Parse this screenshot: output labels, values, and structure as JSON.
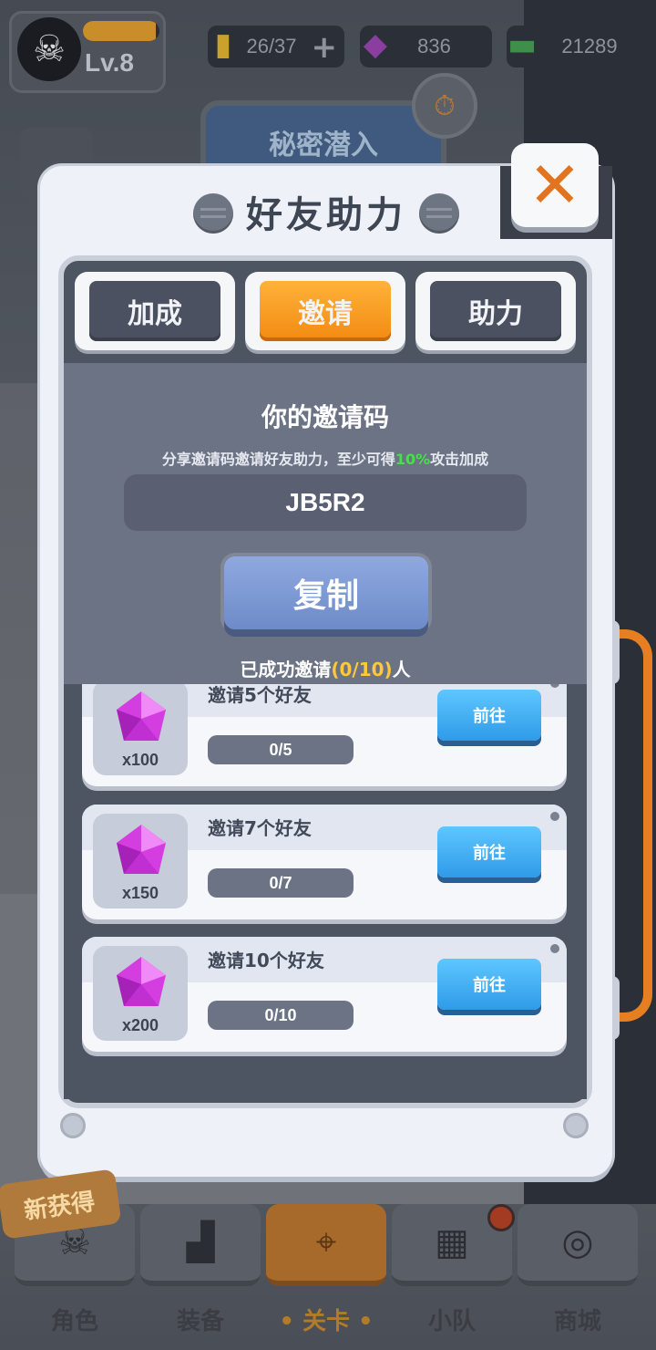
{
  "colors": {
    "accent_orange": "#f28a12",
    "go_blue": "#2f9be8",
    "highlight_green": "#46e04a",
    "highlight_yellow": "#ffc83a",
    "close_x": "#e2741f"
  },
  "hud": {
    "level": "Lv.8",
    "xp_fraction": 0.95,
    "energy": "26/37",
    "gems": "836",
    "cash": "21289",
    "mission_title": "秘密潜入"
  },
  "modal": {
    "title": "好友助力",
    "close_icon": "close-x-icon",
    "tabs": [
      {
        "label": "加成",
        "active": false
      },
      {
        "label": "邀请",
        "active": true
      },
      {
        "label": "助力",
        "active": false
      }
    ],
    "invite": {
      "title": "你的邀请码",
      "subtitle_pre": "分享邀请码邀请好友助力，至少可得",
      "subtitle_hl": "10%",
      "subtitle_post": "攻击加成",
      "code": "JB5R2",
      "copy_label": "复制",
      "invited_pre": "已成功邀请",
      "invited_count": "(0/10)",
      "invited_post": "人"
    },
    "tasks": [
      {
        "title": "邀请5个好友",
        "reward_qty": "x100",
        "progress": "0/5",
        "button": "前往"
      },
      {
        "title": "邀请7个好友",
        "reward_qty": "x150",
        "progress": "0/7",
        "button": "前往"
      },
      {
        "title": "邀请10个好友",
        "reward_qty": "x200",
        "progress": "0/10",
        "button": "前往"
      }
    ]
  },
  "bottom_nav": {
    "new_badge": "新获得",
    "items": [
      {
        "label": "角色",
        "icon": "skull-icon",
        "active": false
      },
      {
        "label": "装备",
        "icon": "gun-icon",
        "active": false
      },
      {
        "label": "• 关卡 •",
        "icon": "map-pin-icon",
        "active": true
      },
      {
        "label": "小队",
        "icon": "squad-icon",
        "active": false
      },
      {
        "label": "商城",
        "icon": "shop-icon",
        "active": false
      }
    ]
  }
}
